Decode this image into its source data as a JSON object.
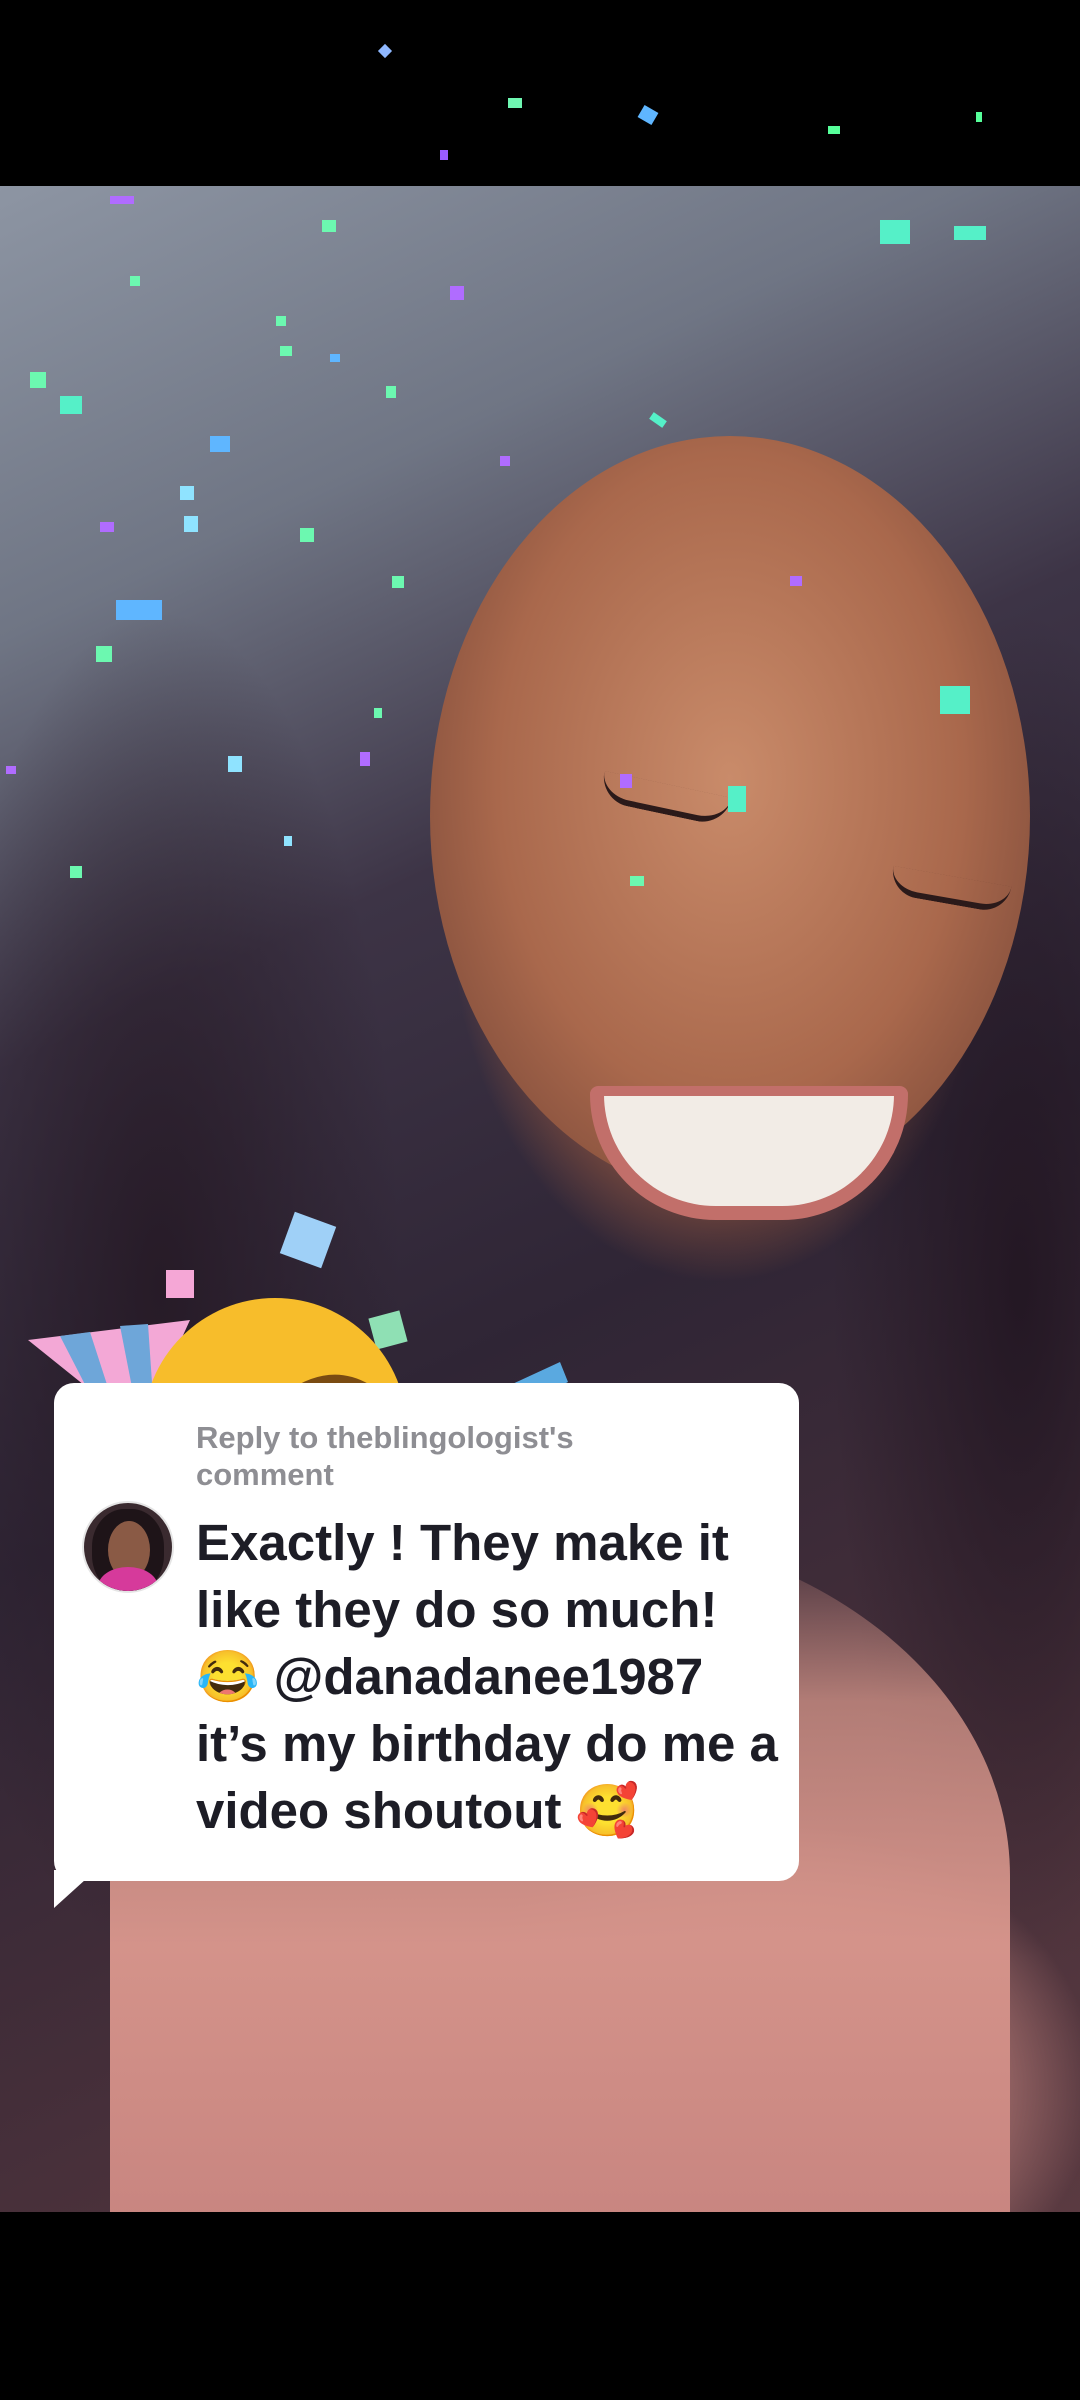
{
  "comment_reply": {
    "header": "Reply to theblingologist's comment",
    "text": "Exactly ! They make it like they do so much! 😂 @danadanee1987 it’s my birthday do me a video shoutout 🥰"
  },
  "icons": [
    "party-face-emoji",
    "confetti",
    "avatar"
  ],
  "colors": {
    "bubble_bg": "#ffffff",
    "header_text": "#8e8e93",
    "comment_text": "#1d1d26",
    "letterbox": "#000000"
  }
}
